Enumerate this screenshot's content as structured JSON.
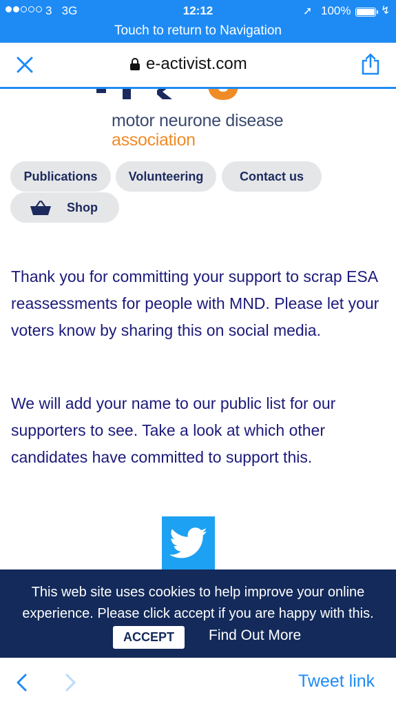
{
  "status_bar": {
    "carrier": "3",
    "network": "3G",
    "time": "12:12",
    "battery": "100%",
    "return_text": "Touch to return to Navigation"
  },
  "browser": {
    "url": "e-activist.com",
    "icons": {
      "close": "close-icon",
      "lock": "lock-icon",
      "share": "share-icon"
    }
  },
  "logo": {
    "line1": "motor neurone disease",
    "line2": "association"
  },
  "nav": {
    "publications": "Publications",
    "volunteering": "Volunteering",
    "contact": "Contact us",
    "shop": "Shop"
  },
  "body": {
    "para1": "Thank you for committing your support to scrap ESA reassessments for people with MND. Please let your voters know by sharing this on social media.",
    "para2": "We will add your name to our public list for our supporters to see. Take a look at which other candidates have committed to support this."
  },
  "cookie_banner": {
    "text": "This web site uses cookies to help improve your online experience. Please click accept if you are happy with this.",
    "accept": "ACCEPT",
    "find_out_more": "Find Out More"
  },
  "toolbar": {
    "tweet_link": "Tweet link"
  },
  "colors": {
    "ios_blue": "#1e8bf5",
    "mnd_navy": "#1c2a5e",
    "mnd_orange": "#f08c28",
    "text_navy": "#1c1a7a",
    "twitter_blue": "#1da1f2",
    "cookie_bg": "#132a5a"
  }
}
